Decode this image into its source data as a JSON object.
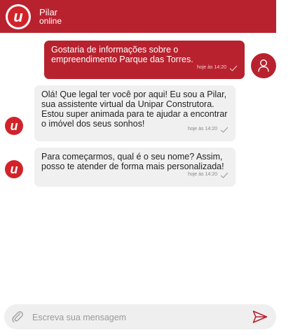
{
  "header": {
    "agent_name": "Pilar",
    "status": "online",
    "logo_letter": "u"
  },
  "messages": [
    {
      "sender": "user",
      "text": "Gostaria de informações sobre o empreendimento Parque das Torres.",
      "time": "hoje às 14:20"
    },
    {
      "sender": "bot",
      "text": "Olá!  Que legal ter você por aqui! Eu sou a Pilar, sua assistente virtual da Unipar Construtora. Estou super animada para te ajudar a encontrar o imóvel dos seus sonhos!",
      "time": "hoje às 14:20"
    },
    {
      "sender": "bot",
      "text": "Para começarmos, qual é o seu nome? Assim, posso te atender de forma mais personalizada!",
      "time": "hoje às 14:20"
    }
  ],
  "composer": {
    "placeholder": "Escreva sua mensagem",
    "value": ""
  },
  "colors": {
    "brand": "#b8222e",
    "bubble_bot": "#f0f0f0",
    "composer_bg": "#efefef"
  },
  "icons": {
    "attach": "paperclip-icon",
    "send": "send-icon",
    "user_avatar": "user-icon",
    "read_receipt": "check-icon"
  }
}
